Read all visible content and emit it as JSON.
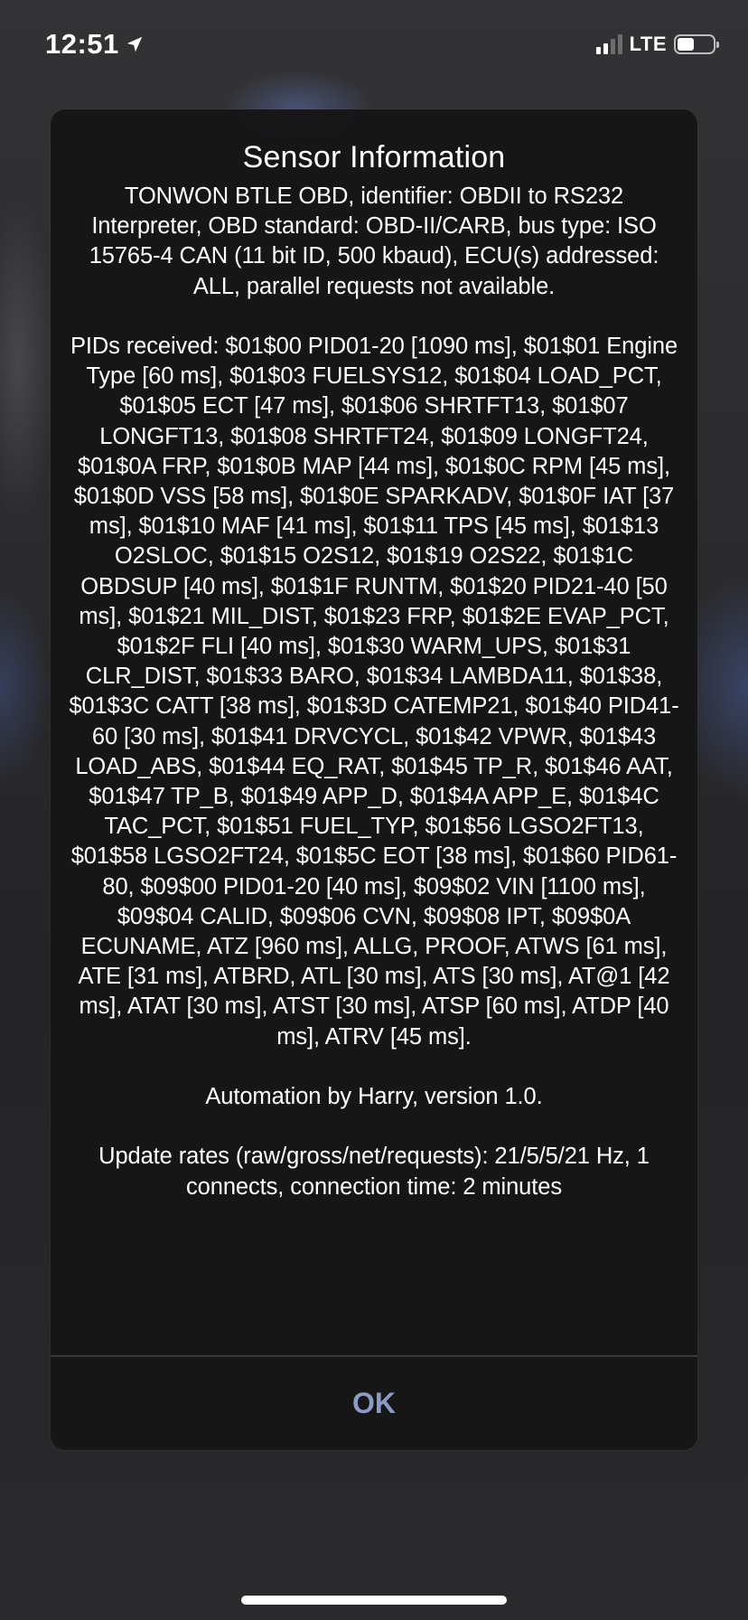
{
  "status_bar": {
    "time": "12:51",
    "network": "LTE"
  },
  "dialog": {
    "title": "Sensor Information",
    "paragraphs": [
      "TONWON BTLE OBD, identifier: OBDII to RS232 Interpreter, OBD standard: OBD-II/CARB, bus type: ISO 15765-4 CAN (11 bit ID, 500 kbaud), ECU(s) addressed: ALL, parallel requests not available.",
      "PIDs received: $01$00 PID01-20 [1090 ms], $01$01 Engine Type [60 ms], $01$03 FUELSYS12, $01$04 LOAD_PCT, $01$05 ECT [47 ms], $01$06 SHRTFT13, $01$07 LONGFT13, $01$08 SHRTFT24, $01$09 LONGFT24, $01$0A FRP, $01$0B MAP [44 ms], $01$0C RPM [45 ms], $01$0D VSS [58 ms], $01$0E SPARKADV, $01$0F IAT [37 ms], $01$10 MAF [41 ms], $01$11 TPS [45 ms], $01$13 O2SLOC, $01$15 O2S12, $01$19 O2S22, $01$1C OBDSUP [40 ms], $01$1F RUNTM, $01$20 PID21-40 [50 ms], $01$21 MIL_DIST, $01$23 FRP, $01$2E EVAP_PCT, $01$2F FLI [40 ms], $01$30 WARM_UPS, $01$31 CLR_DIST, $01$33 BARO, $01$34 LAMBDA11, $01$38, $01$3C CATT [38 ms], $01$3D CATEMP21, $01$40 PID41-60 [30 ms], $01$41 DRVCYCL, $01$42 VPWR, $01$43 LOAD_ABS, $01$44 EQ_RAT, $01$45 TP_R, $01$46 AAT, $01$47 TP_B, $01$49 APP_D, $01$4A APP_E, $01$4C TAC_PCT, $01$51 FUEL_TYP, $01$56 LGSO2FT13, $01$58 LGSO2FT24, $01$5C EOT [38 ms], $01$60 PID61-80, $09$00 PID01-20 [40 ms], $09$02 VIN [1100 ms], $09$04 CALID, $09$06 CVN, $09$08 IPT, $09$0A ECUNAME, ATZ [960 ms], ALLG, PROOF, ATWS [61 ms], ATE [31 ms], ATBRD, ATL [30 ms], ATS [30 ms], AT@1 [42 ms], ATAT [30 ms], ATST [30 ms], ATSP [60 ms], ATDP [40 ms], ATRV [45 ms].",
      "Automation by Harry, version 1.0.",
      "Update rates (raw/gross/net/requests): 21/5/5/21 Hz, 1 connects, connection time: 2 minutes"
    ],
    "ok_label": "OK"
  },
  "colors": {
    "ok_button_text": "#8b9ac7",
    "dialog_background": "#161617"
  },
  "icons": {
    "location": "location-arrow-icon",
    "signal": "cellular-signal-icon",
    "battery": "battery-icon"
  }
}
